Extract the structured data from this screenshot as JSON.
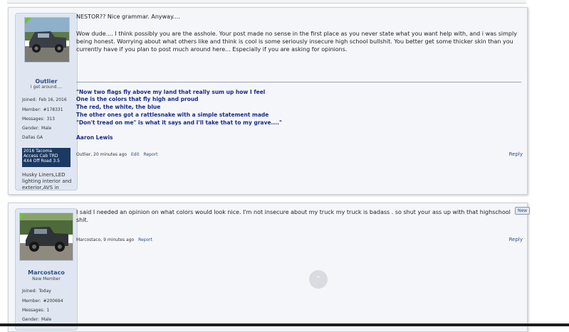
{
  "post1": {
    "username": "Outlier",
    "user_title": "I get around....",
    "stats": [
      {
        "label": "Joined:",
        "value": "Feb 16, 2016"
      },
      {
        "label": "Member:",
        "value": "#178331"
      },
      {
        "label": "Messages:",
        "value": "313"
      },
      {
        "label": "Gender:",
        "value": "Male"
      }
    ],
    "location": "Dallas GA",
    "truck_lines": [
      "2016 Tacoma",
      "Access Cab TRD",
      "4X4 Off Road 3.5"
    ],
    "signature_user": "Husky Liners,LED lighting interior and exterior,AVS in",
    "message_paragraphs": [
      "NESTOR?? Nice grammar. Anyway....",
      "Wow dude.... I think possibly you are the asshole. Your post made no sense in the first place as you never state what you want help with, and i was simply being honest. Worrying about what others like and think is cool is some seriously insecure high school bullshit. You better get some thicker skin than you currently have if you plan to post much around here... Especially if you are asking for opinions."
    ],
    "quote_lines": [
      "\"Now two flags fly above my land that really sum up how I feel",
      "One is the colors that fly high and proud",
      "The red, the white, the blue",
      "The other ones got a rattlesnake with a simple statement made",
      "\"Don't tread on me\" is what it says and I'll take that to my grave....\""
    ],
    "quote_author": "Aaron Lewis",
    "meta_text": "Outlier, 20 minutes ago",
    "edit_label": "Edit",
    "report_label": "Report",
    "reply_label": "Reply"
  },
  "post2": {
    "username": "Marcostaco",
    "user_title": "New Member",
    "stats": [
      {
        "label": "Joined:",
        "value": "Today"
      },
      {
        "label": "Member:",
        "value": "#200694"
      },
      {
        "label": "Messages:",
        "value": "1"
      },
      {
        "label": "Gender:",
        "value": "Male"
      }
    ],
    "message": "I said I needed an opinion on what colors would look nice. I'm not insecure about my truck my truck is badass . so shut your ass up with that highschool shit.",
    "meta_text": "Marcostaco, 9 minutes ago",
    "report_label": "Report",
    "reply_label": "Reply",
    "new_badge": "New"
  },
  "colors": {
    "accent": "#2b4f86",
    "quote": "#1a2a8c",
    "userpanel": "#dfe6f1",
    "truckbox": "#1b3a63"
  },
  "icons": {
    "scroll_top": "chevron-up-icon",
    "online": "online-indicator-icon"
  }
}
